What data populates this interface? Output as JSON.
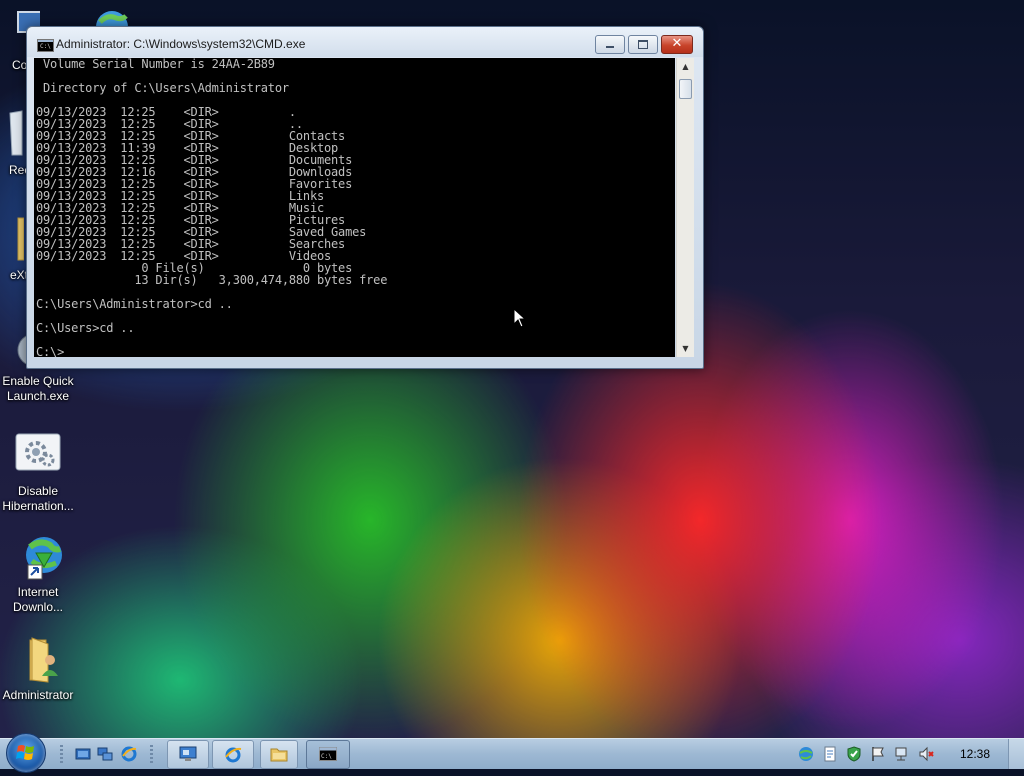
{
  "desktop": {
    "icons": [
      {
        "label": "Co"
      },
      {
        "label": "Rec"
      },
      {
        "label": "eXt"
      },
      {
        "label": "Enable Quick Launch.exe"
      },
      {
        "label": "Disable Hibernation..."
      },
      {
        "label": "Internet Downlo..."
      },
      {
        "label": "Administrator"
      }
    ]
  },
  "cmd_window": {
    "title": "Administrator: C:\\Windows\\system32\\CMD.exe",
    "output": " Volume Serial Number is 24AA-2B89\n\n Directory of C:\\Users\\Administrator\n\n09/13/2023  12:25    <DIR>          .\n09/13/2023  12:25    <DIR>          ..\n09/13/2023  12:25    <DIR>          Contacts\n09/13/2023  11:39    <DIR>          Desktop\n09/13/2023  12:25    <DIR>          Documents\n09/13/2023  12:16    <DIR>          Downloads\n09/13/2023  12:25    <DIR>          Favorites\n09/13/2023  12:25    <DIR>          Links\n09/13/2023  12:25    <DIR>          Music\n09/13/2023  12:25    <DIR>          Pictures\n09/13/2023  12:25    <DIR>          Saved Games\n09/13/2023  12:25    <DIR>          Searches\n09/13/2023  12:25    <DIR>          Videos\n               0 File(s)              0 bytes\n              13 Dir(s)   3,300,474,880 bytes free\n\nC:\\Users\\Administrator>cd ..\n\nC:\\Users>cd ..\n\nC:\\>",
    "console_bg": "#000000",
    "console_fg": "#c0c0c0"
  },
  "taskbar": {
    "clock": "12:38",
    "quick_launch": [
      "show-desktop-icon",
      "switch-windows-icon",
      "internet-explorer-icon"
    ],
    "task_buttons": [
      "remote-desktop-icon",
      "internet-explorer-icon",
      "windows-explorer-icon",
      "cmd-icon"
    ],
    "tray_icons": [
      "network-globe-icon",
      "notepad-icon",
      "security-shield-icon",
      "action-center-flag-icon",
      "network-icon",
      "volume-muted-icon"
    ]
  }
}
